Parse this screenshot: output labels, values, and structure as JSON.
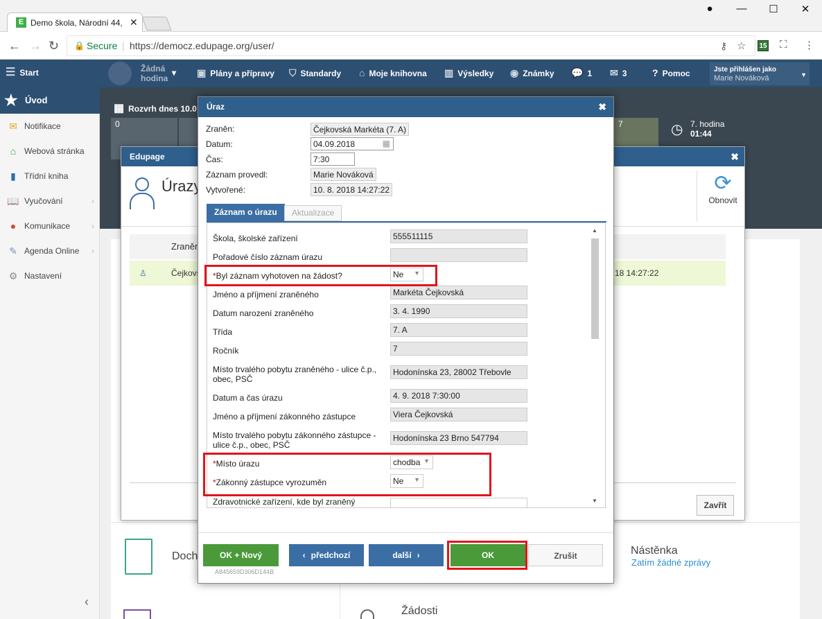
{
  "browser": {
    "tab_title": "Demo škola, Národní 44,",
    "secure": "Secure",
    "url": "https://democz.edupage.org/user/",
    "ext_badge": "15"
  },
  "topnav": {
    "start": "Start",
    "zadna_hodina": "Žádná hodina",
    "plany": "Plány a přípravy",
    "standardy": "Standardy",
    "knihovna": "Moje knihovna",
    "vysledky": "Výsledky",
    "znamky": "Známky",
    "msg_count": "1",
    "mail_count": "3",
    "pomoc": "Pomoc",
    "logged_as": "Jste přihlášen jako",
    "user": "Marie Nováková"
  },
  "sidebar": {
    "uvod": "Úvod",
    "items": [
      {
        "label": "Notifikace",
        "icon": "mail-icon"
      },
      {
        "label": "Webová stránka",
        "icon": "home-icon"
      },
      {
        "label": "Třídní kniha",
        "icon": "book-icon"
      },
      {
        "label": "Vyučování",
        "icon": "open-book-icon"
      },
      {
        "label": "Komunikace",
        "icon": "chat-icon"
      },
      {
        "label": "Agenda Online",
        "icon": "pen-icon"
      },
      {
        "label": "Nastavení",
        "icon": "gear-icon"
      }
    ]
  },
  "background": {
    "rozvrh": "Rozvrh dnes 10.0",
    "cell0": "0",
    "cell7": "7",
    "hodina_label": "7. hodina",
    "hodina_time": "01:44",
    "doch": "Doch",
    "nastenka": "Nástěnka",
    "nastenka_sub": "Zatím žádné zprávy",
    "zadosti": "Žádosti"
  },
  "edupage_modal": {
    "header": "Edupage",
    "title": "Úrazy",
    "refresh": "Obnovit",
    "col_zranen": "Zraněn",
    "row_name": "Čejkovs",
    "row_time": "18 14:27:22",
    "close": "Zavřít"
  },
  "uraz": {
    "header": "Úraz",
    "fields": {
      "zranen_label": "Zraněn:",
      "zranen": "Čejkovská Markéta (7. A)",
      "datum_label": "Datum:",
      "datum": "04.09.2018",
      "cas_label": "Čas:",
      "cas": "7:30",
      "provedl_label": "Záznam provedl:",
      "provedl": "Marie Nováková",
      "vytvorene_label": "Vytvořené:",
      "vytvorene": "10. 8. 2018 14:27:22"
    },
    "tabs": [
      "Záznam o úrazu",
      "Aktualizace"
    ],
    "form": {
      "skola_label": "Škola, školské zařízení",
      "skola": "555511115",
      "poradove_label": "Pořadové číslo záznam úrazu",
      "poradove": "",
      "zadost_label": "Byl záznam vyhotoven na žádost?",
      "zadost": "Ne",
      "jmeno_label": "Jméno a příjmení zraněného",
      "jmeno": "Markéta Čejkovská",
      "narozeni_label": "Datum narození zraněného",
      "narozeni": "3. 4. 1990",
      "trida_label": "Třída",
      "trida": "7. A",
      "rocnik_label": "Ročník",
      "rocnik": "7",
      "pobyt_label": "Místo trvalého pobytu zraněného - ulice č.p., obec, PSČ",
      "pobyt": "Hodonínska 23, 28002 Třebovle",
      "datumcas_label": "Datum a čas úrazu",
      "datumcas": "4. 9. 2018 7:30:00",
      "zastupce_label": "Jméno a příjmení zákonného zástupce",
      "zastupce": "Viera Čejkovská",
      "pobyt2_label": "Místo trvalého pobytu zákonného zástupce - ulice č.p., obec, PSČ",
      "pobyt2": "Hodonínska 23 Brno 547794",
      "misto_label": "Místo úrazu",
      "misto": "chodba",
      "vyrozumen_label": "Zákonný zástupce vyrozuměn",
      "vyrozumen": "Ne",
      "zdrav_label": "Zdravotnické zařízení, kde byl zraněný"
    },
    "buttons": {
      "ok_novy": "OK + Nový",
      "predchozi": "předchozí",
      "dalsi": "další",
      "ok": "OK",
      "zrusit": "Zrušit"
    },
    "code": "A845659D306D144B"
  },
  "colors": {
    "nav": "#2d4f72",
    "modal_header": "#2e5f8d",
    "green": "#4a9a3a",
    "blue": "#3a6ea5",
    "highlight": "#e0151c"
  }
}
